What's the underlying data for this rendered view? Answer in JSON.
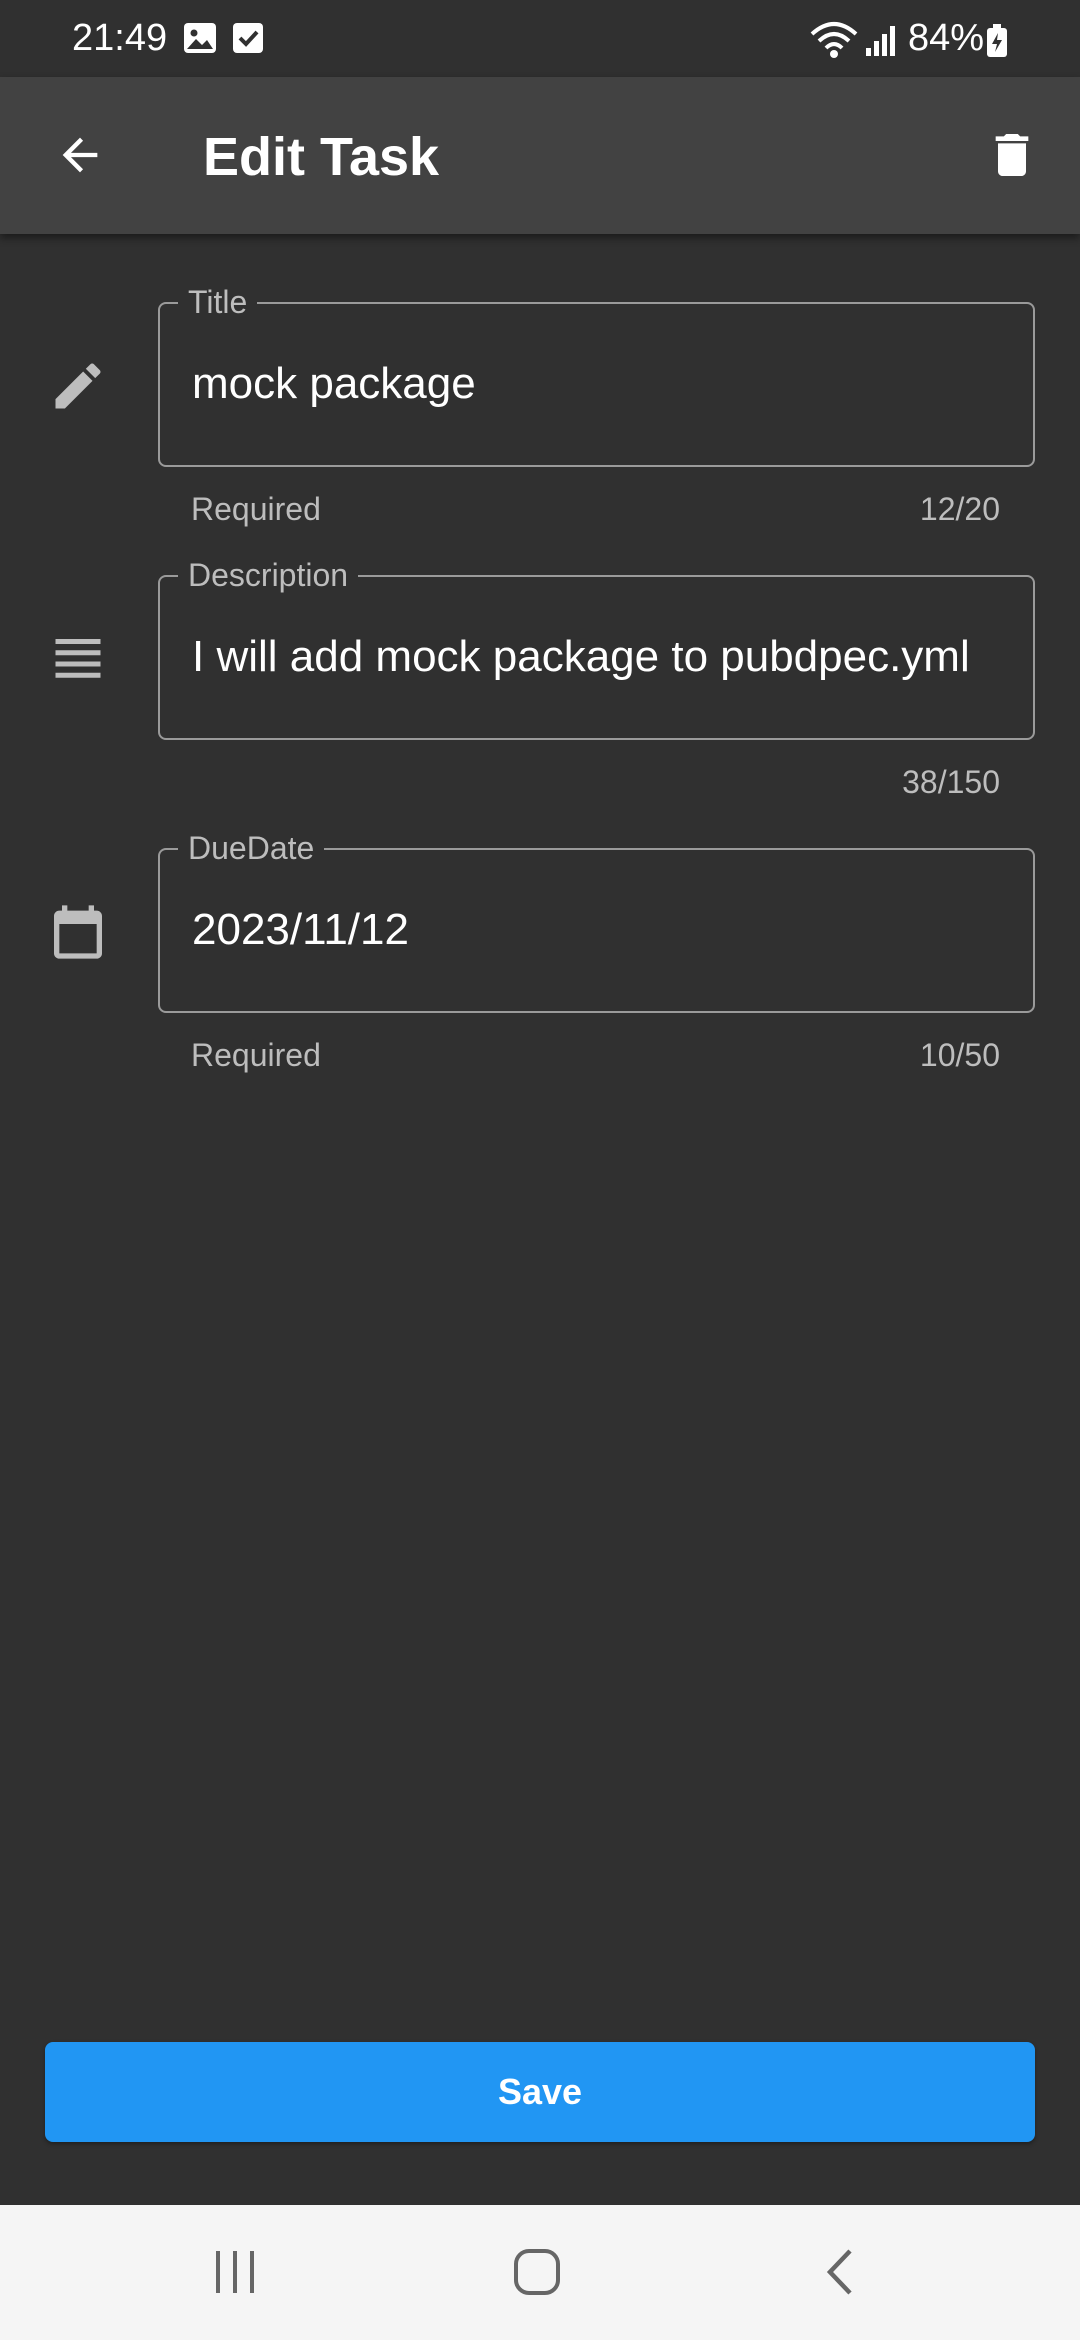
{
  "status_bar": {
    "time": "21:49",
    "battery": "84%",
    "icons": [
      "image-icon",
      "checkbox-icon",
      "wifi-icon",
      "signal-icon",
      "battery-icon"
    ]
  },
  "app_bar": {
    "title": "Edit Task",
    "back_icon": "arrow-back-icon",
    "delete_icon": "trash-icon"
  },
  "form": {
    "title": {
      "label": "Title",
      "value": "mock package",
      "helper": "Required",
      "counter": "12/20",
      "icon": "pencil-icon"
    },
    "description": {
      "label": "Description",
      "value": "I will add mock package to pubdpec.yml",
      "counter": "38/150",
      "icon": "notes-icon"
    },
    "due_date": {
      "label": "DueDate",
      "value": "2023/11/12",
      "helper": "Required",
      "counter": "10/50",
      "icon": "calendar-icon"
    }
  },
  "save_button": {
    "label": "Save"
  },
  "nav_bar": {
    "items": [
      "recents-icon",
      "home-icon",
      "back-icon"
    ]
  },
  "colors": {
    "background": "#303030",
    "app_bar": "#424242",
    "accent": "#2196f3",
    "field_border": "#9a9a9a",
    "secondary_text": "#bdbdbd"
  }
}
